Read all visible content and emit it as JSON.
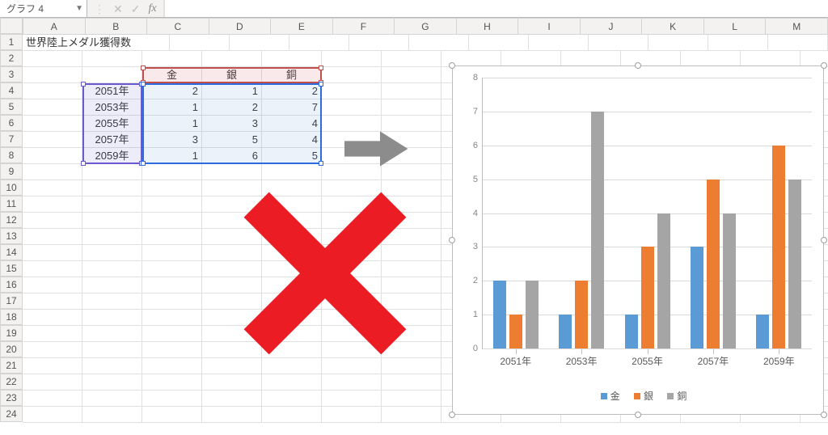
{
  "toolbar": {
    "namebox_value": "グラフ 4",
    "formula_value": "",
    "icons": {
      "dropdown": "▼",
      "cancel": "✕",
      "confirm": "✓",
      "fx": "fx"
    }
  },
  "columns": [
    "A",
    "B",
    "C",
    "D",
    "E",
    "F",
    "G",
    "H",
    "I",
    "J",
    "K",
    "L",
    "M"
  ],
  "rows": [
    "1",
    "2",
    "3",
    "4",
    "5",
    "6",
    "7",
    "8",
    "9",
    "10",
    "11",
    "12",
    "13",
    "14",
    "15",
    "16",
    "17",
    "18",
    "19",
    "20",
    "21",
    "22",
    "23",
    "24"
  ],
  "title_cell": "世界陸上メダル獲得数",
  "table": {
    "headers": [
      "金",
      "銀",
      "銅"
    ],
    "categories": [
      "2051年",
      "2053年",
      "2055年",
      "2057年",
      "2059年"
    ],
    "values": [
      [
        2,
        1,
        2
      ],
      [
        1,
        2,
        7
      ],
      [
        1,
        3,
        4
      ],
      [
        3,
        5,
        4
      ],
      [
        1,
        6,
        5
      ]
    ]
  },
  "chart_data": {
    "type": "bar",
    "categories": [
      "2051年",
      "2053年",
      "2055年",
      "2057年",
      "2059年"
    ],
    "series": [
      {
        "name": "金",
        "color": "#5b9bd5",
        "values": [
          2,
          1,
          1,
          3,
          1
        ]
      },
      {
        "name": "銀",
        "color": "#ed7d31",
        "values": [
          1,
          2,
          3,
          5,
          6
        ]
      },
      {
        "name": "銅",
        "color": "#a5a5a5",
        "values": [
          2,
          7,
          4,
          4,
          5
        ]
      }
    ],
    "yticks": [
      0,
      1,
      2,
      3,
      4,
      5,
      6,
      7,
      8
    ],
    "ymax": 8,
    "xlabel": "",
    "ylabel": "",
    "title": ""
  },
  "legend": {
    "items": [
      "金",
      "銀",
      "銅"
    ]
  }
}
